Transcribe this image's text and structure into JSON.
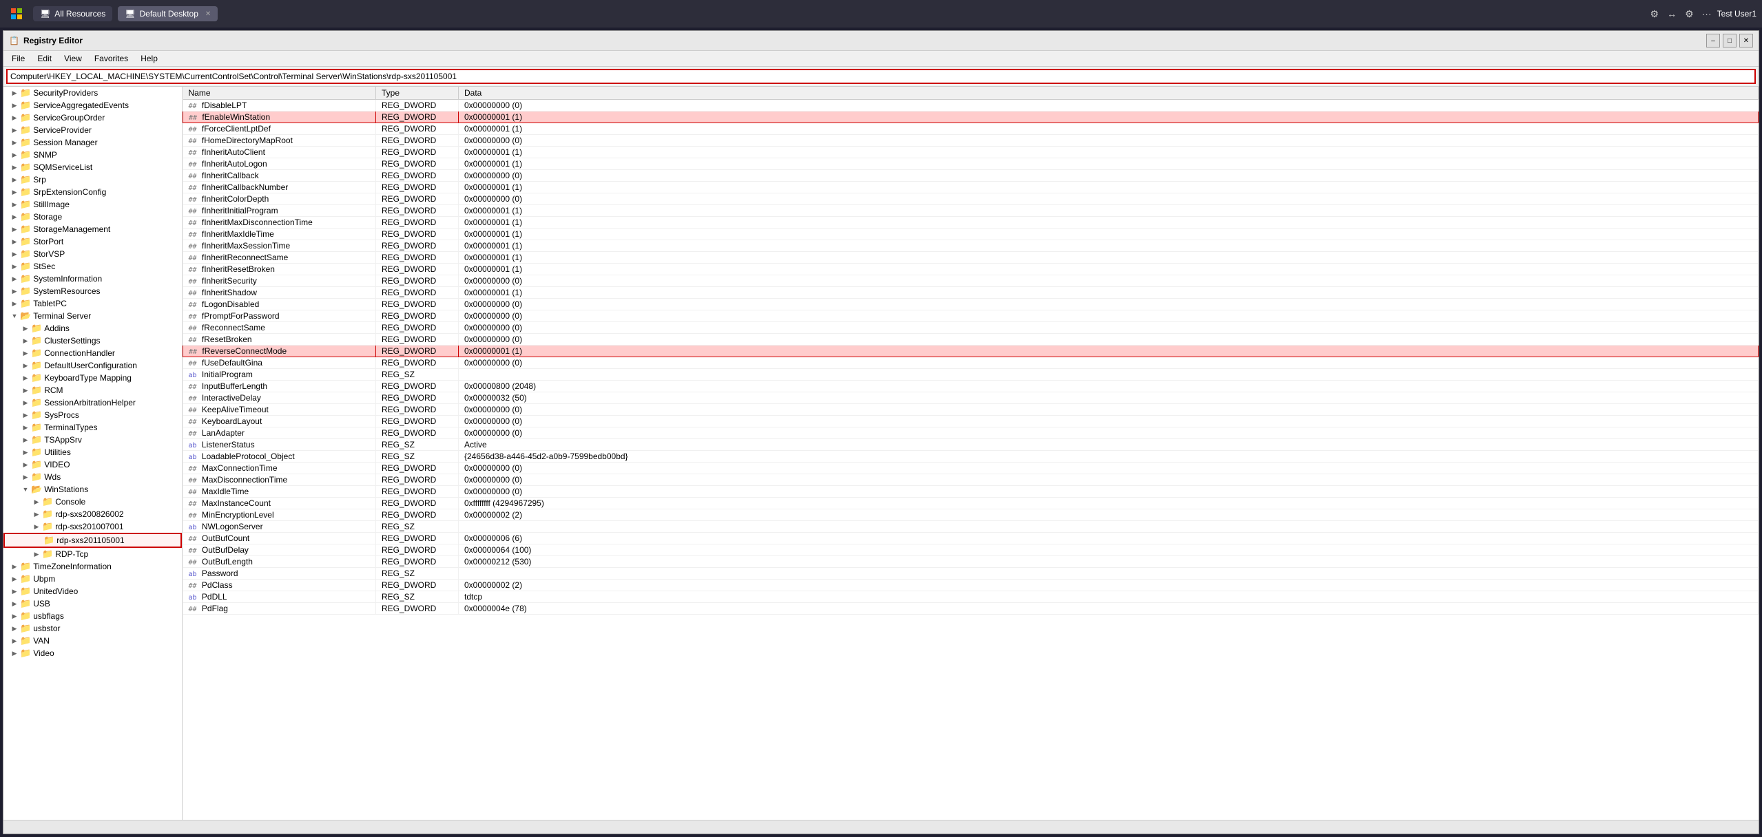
{
  "taskbar": {
    "start_icon": "⊞",
    "tabs": [
      {
        "label": "All Resources",
        "icon": "🖥",
        "active": false
      },
      {
        "label": "Default Desktop",
        "icon": "🖥",
        "active": true,
        "closable": true
      }
    ],
    "icons": [
      "⚙",
      "↔",
      "⚙",
      "···"
    ],
    "user": "Test User1"
  },
  "window": {
    "title": "Registry Editor",
    "app_icon": "📋",
    "menu_items": [
      "File",
      "Edit",
      "View",
      "Favorites",
      "Help"
    ]
  },
  "address": {
    "value": "Computer\\HKEY_LOCAL_MACHINE\\SYSTEM\\CurrentControlSet\\Control\\Terminal Server\\WinStations\\rdp-sxs201105001",
    "placeholder": ""
  },
  "tree": {
    "items": [
      {
        "label": "SecurityProviders",
        "level": 2,
        "toggle": "collapsed",
        "selected": false
      },
      {
        "label": "ServiceAggregatedEvents",
        "level": 2,
        "toggle": "collapsed",
        "selected": false
      },
      {
        "label": "ServiceGroupOrder",
        "level": 2,
        "toggle": "collapsed",
        "selected": false
      },
      {
        "label": "ServiceProvider",
        "level": 2,
        "toggle": "collapsed",
        "selected": false
      },
      {
        "label": "Session Manager",
        "level": 2,
        "toggle": "collapsed",
        "selected": false
      },
      {
        "label": "SNMP",
        "level": 2,
        "toggle": "collapsed",
        "selected": false
      },
      {
        "label": "SQMServiceList",
        "level": 2,
        "toggle": "collapsed",
        "selected": false
      },
      {
        "label": "Srp",
        "level": 2,
        "toggle": "collapsed",
        "selected": false
      },
      {
        "label": "SrpExtensionConfig",
        "level": 2,
        "toggle": "collapsed",
        "selected": false
      },
      {
        "label": "StillImage",
        "level": 2,
        "toggle": "collapsed",
        "selected": false
      },
      {
        "label": "Storage",
        "level": 2,
        "toggle": "collapsed",
        "selected": false
      },
      {
        "label": "StorageManagement",
        "level": 2,
        "toggle": "collapsed",
        "selected": false
      },
      {
        "label": "StorPort",
        "level": 2,
        "toggle": "collapsed",
        "selected": false
      },
      {
        "label": "StorVSP",
        "level": 2,
        "toggle": "collapsed",
        "selected": false
      },
      {
        "label": "StSec",
        "level": 2,
        "toggle": "collapsed",
        "selected": false
      },
      {
        "label": "SystemInformation",
        "level": 2,
        "toggle": "collapsed",
        "selected": false
      },
      {
        "label": "SystemResources",
        "level": 2,
        "toggle": "collapsed",
        "selected": false
      },
      {
        "label": "TabletPC",
        "level": 2,
        "toggle": "collapsed",
        "selected": false
      },
      {
        "label": "Terminal Server",
        "level": 2,
        "toggle": "expanded",
        "selected": false
      },
      {
        "label": "Addins",
        "level": 3,
        "toggle": "collapsed",
        "selected": false
      },
      {
        "label": "ClusterSettings",
        "level": 3,
        "toggle": "collapsed",
        "selected": false
      },
      {
        "label": "ConnectionHandler",
        "level": 3,
        "toggle": "collapsed",
        "selected": false
      },
      {
        "label": "DefaultUserConfiguration",
        "level": 3,
        "toggle": "collapsed",
        "selected": false
      },
      {
        "label": "KeyboardType Mapping",
        "level": 3,
        "toggle": "collapsed",
        "selected": false
      },
      {
        "label": "RCM",
        "level": 3,
        "toggle": "collapsed",
        "selected": false
      },
      {
        "label": "SessionArbitrationHelper",
        "level": 3,
        "toggle": "collapsed",
        "selected": false
      },
      {
        "label": "SysProcs",
        "level": 3,
        "toggle": "collapsed",
        "selected": false
      },
      {
        "label": "TerminalTypes",
        "level": 3,
        "toggle": "collapsed",
        "selected": false
      },
      {
        "label": "TSAppSrv",
        "level": 3,
        "toggle": "collapsed",
        "selected": false
      },
      {
        "label": "Utilities",
        "level": 3,
        "toggle": "collapsed",
        "selected": false
      },
      {
        "label": "VIDEO",
        "level": 3,
        "toggle": "collapsed",
        "selected": false
      },
      {
        "label": "Wds",
        "level": 3,
        "toggle": "collapsed",
        "selected": false
      },
      {
        "label": "WinStations",
        "level": 3,
        "toggle": "expanded",
        "selected": false
      },
      {
        "label": "Console",
        "level": 4,
        "toggle": "collapsed",
        "selected": false
      },
      {
        "label": "rdp-sxs200826002",
        "level": 4,
        "toggle": "collapsed",
        "selected": false
      },
      {
        "label": "rdp-sxs201007001",
        "level": 4,
        "toggle": "collapsed",
        "selected": false
      },
      {
        "label": "rdp-sxs201105001",
        "level": 4,
        "toggle": "empty",
        "selected": true
      },
      {
        "label": "RDP-Tcp",
        "level": 4,
        "toggle": "collapsed",
        "selected": false
      },
      {
        "label": "TimeZoneInformation",
        "level": 2,
        "toggle": "collapsed",
        "selected": false
      },
      {
        "label": "Ubpm",
        "level": 2,
        "toggle": "collapsed",
        "selected": false
      },
      {
        "label": "UnitedVideo",
        "level": 2,
        "toggle": "collapsed",
        "selected": false
      },
      {
        "label": "USB",
        "level": 2,
        "toggle": "collapsed",
        "selected": false
      },
      {
        "label": "usbflags",
        "level": 2,
        "toggle": "collapsed",
        "selected": false
      },
      {
        "label": "usbstor",
        "level": 2,
        "toggle": "collapsed",
        "selected": false
      },
      {
        "label": "VAN",
        "level": 2,
        "toggle": "collapsed",
        "selected": false
      },
      {
        "label": "Video",
        "level": 2,
        "toggle": "collapsed",
        "selected": false
      }
    ]
  },
  "registry": {
    "columns": [
      "Name",
      "Type",
      "Data"
    ],
    "rows": [
      {
        "name": "fDisableLPT",
        "type": "REG_DWORD",
        "data": "0x00000000 (0)",
        "highlight": false,
        "icon": "dword"
      },
      {
        "name": "fEnableWinStation",
        "type": "REG_DWORD",
        "data": "0x00000001 (1)",
        "highlight": true,
        "icon": "dword"
      },
      {
        "name": "fForceClientLptDef",
        "type": "REG_DWORD",
        "data": "0x00000001 (1)",
        "highlight": false,
        "icon": "dword"
      },
      {
        "name": "fHomeDirectoryMapRoot",
        "type": "REG_DWORD",
        "data": "0x00000000 (0)",
        "highlight": false,
        "icon": "dword"
      },
      {
        "name": "fInheritAutoClient",
        "type": "REG_DWORD",
        "data": "0x00000001 (1)",
        "highlight": false,
        "icon": "dword"
      },
      {
        "name": "fInheritAutoLogon",
        "type": "REG_DWORD",
        "data": "0x00000001 (1)",
        "highlight": false,
        "icon": "dword"
      },
      {
        "name": "fInheritCallback",
        "type": "REG_DWORD",
        "data": "0x00000000 (0)",
        "highlight": false,
        "icon": "dword"
      },
      {
        "name": "fInheritCallbackNumber",
        "type": "REG_DWORD",
        "data": "0x00000001 (1)",
        "highlight": false,
        "icon": "dword"
      },
      {
        "name": "fInheritColorDepth",
        "type": "REG_DWORD",
        "data": "0x00000000 (0)",
        "highlight": false,
        "icon": "dword"
      },
      {
        "name": "fInheritInitialProgram",
        "type": "REG_DWORD",
        "data": "0x00000001 (1)",
        "highlight": false,
        "icon": "dword"
      },
      {
        "name": "fInheritMaxDisconnectionTime",
        "type": "REG_DWORD",
        "data": "0x00000001 (1)",
        "highlight": false,
        "icon": "dword"
      },
      {
        "name": "fInheritMaxIdleTime",
        "type": "REG_DWORD",
        "data": "0x00000001 (1)",
        "highlight": false,
        "icon": "dword"
      },
      {
        "name": "fInheritMaxSessionTime",
        "type": "REG_DWORD",
        "data": "0x00000001 (1)",
        "highlight": false,
        "icon": "dword"
      },
      {
        "name": "fInheritReconnectSame",
        "type": "REG_DWORD",
        "data": "0x00000001 (1)",
        "highlight": false,
        "icon": "dword"
      },
      {
        "name": "fInheritResetBroken",
        "type": "REG_DWORD",
        "data": "0x00000001 (1)",
        "highlight": false,
        "icon": "dword"
      },
      {
        "name": "fInheritSecurity",
        "type": "REG_DWORD",
        "data": "0x00000000 (0)",
        "highlight": false,
        "icon": "dword"
      },
      {
        "name": "fInheritShadow",
        "type": "REG_DWORD",
        "data": "0x00000001 (1)",
        "highlight": false,
        "icon": "dword"
      },
      {
        "name": "fLogonDisabled",
        "type": "REG_DWORD",
        "data": "0x00000000 (0)",
        "highlight": false,
        "icon": "dword"
      },
      {
        "name": "fPromptForPassword",
        "type": "REG_DWORD",
        "data": "0x00000000 (0)",
        "highlight": false,
        "icon": "dword"
      },
      {
        "name": "fReconnectSame",
        "type": "REG_DWORD",
        "data": "0x00000000 (0)",
        "highlight": false,
        "icon": "dword"
      },
      {
        "name": "fResetBroken",
        "type": "REG_DWORD",
        "data": "0x00000000 (0)",
        "highlight": false,
        "icon": "dword"
      },
      {
        "name": "fReverseConnectMode",
        "type": "REG_DWORD",
        "data": "0x00000001 (1)",
        "highlight": true,
        "icon": "dword"
      },
      {
        "name": "fUseDefaultGina",
        "type": "REG_DWORD",
        "data": "0x00000000 (0)",
        "highlight": false,
        "icon": "dword"
      },
      {
        "name": "InitialProgram",
        "type": "REG_SZ",
        "data": "",
        "highlight": false,
        "icon": "sz"
      },
      {
        "name": "InputBufferLength",
        "type": "REG_DWORD",
        "data": "0x00000800 (2048)",
        "highlight": false,
        "icon": "dword"
      },
      {
        "name": "InteractiveDelay",
        "type": "REG_DWORD",
        "data": "0x00000032 (50)",
        "highlight": false,
        "icon": "dword"
      },
      {
        "name": "KeepAliveTimeout",
        "type": "REG_DWORD",
        "data": "0x00000000 (0)",
        "highlight": false,
        "icon": "dword"
      },
      {
        "name": "KeyboardLayout",
        "type": "REG_DWORD",
        "data": "0x00000000 (0)",
        "highlight": false,
        "icon": "dword"
      },
      {
        "name": "LanAdapter",
        "type": "REG_DWORD",
        "data": "0x00000000 (0)",
        "highlight": false,
        "icon": "dword"
      },
      {
        "name": "ListenerStatus",
        "type": "REG_SZ",
        "data": "Active",
        "highlight": false,
        "icon": "sz"
      },
      {
        "name": "LoadableProtocol_Object",
        "type": "REG_SZ",
        "data": "{24656d38-a446-45d2-a0b9-7599bedb00bd}",
        "highlight": false,
        "icon": "sz"
      },
      {
        "name": "MaxConnectionTime",
        "type": "REG_DWORD",
        "data": "0x00000000 (0)",
        "highlight": false,
        "icon": "dword"
      },
      {
        "name": "MaxDisconnectionTime",
        "type": "REG_DWORD",
        "data": "0x00000000 (0)",
        "highlight": false,
        "icon": "dword"
      },
      {
        "name": "MaxIdleTime",
        "type": "REG_DWORD",
        "data": "0x00000000 (0)",
        "highlight": false,
        "icon": "dword"
      },
      {
        "name": "MaxInstanceCount",
        "type": "REG_DWORD",
        "data": "0xffffffff (4294967295)",
        "highlight": false,
        "icon": "dword"
      },
      {
        "name": "MinEncryptionLevel",
        "type": "REG_DWORD",
        "data": "0x00000002 (2)",
        "highlight": false,
        "icon": "dword"
      },
      {
        "name": "NWLogonServer",
        "type": "REG_SZ",
        "data": "",
        "highlight": false,
        "icon": "sz"
      },
      {
        "name": "OutBufCount",
        "type": "REG_DWORD",
        "data": "0x00000006 (6)",
        "highlight": false,
        "icon": "dword"
      },
      {
        "name": "OutBufDelay",
        "type": "REG_DWORD",
        "data": "0x00000064 (100)",
        "highlight": false,
        "icon": "dword"
      },
      {
        "name": "OutBufLength",
        "type": "REG_DWORD",
        "data": "0x00000212 (530)",
        "highlight": false,
        "icon": "dword"
      },
      {
        "name": "Password",
        "type": "REG_SZ",
        "data": "",
        "highlight": false,
        "icon": "sz"
      },
      {
        "name": "PdClass",
        "type": "REG_DWORD",
        "data": "0x00000002 (2)",
        "highlight": false,
        "icon": "dword"
      },
      {
        "name": "PdDLL",
        "type": "REG_SZ",
        "data": "tdtcp",
        "highlight": false,
        "icon": "sz"
      },
      {
        "name": "PdFlag",
        "type": "REG_DWORD",
        "data": "0x0000004e (78)",
        "highlight": false,
        "icon": "dword"
      }
    ]
  },
  "statusbar": {
    "text": ""
  }
}
